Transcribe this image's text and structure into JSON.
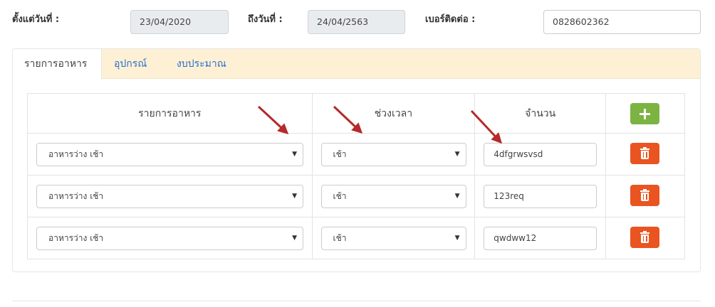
{
  "filters": {
    "start_date_label": "ตั้งแต่วันที่ :",
    "start_date_value": "23/04/2020",
    "end_date_label": "ถึงวันที่ :",
    "end_date_value": "24/04/2563",
    "phone_label": "เบอร์ติดต่อ :",
    "phone_value": "0828602362"
  },
  "tabs": [
    {
      "label": "รายการอาหาร",
      "active": true
    },
    {
      "label": "อุปกรณ์",
      "active": false
    },
    {
      "label": "งบประมาณ",
      "active": false
    }
  ],
  "table": {
    "headers": [
      "รายการอาหาร",
      "ช่วงเวลา",
      "จำนวน"
    ],
    "rows": [
      {
        "food": "อาหารว่าง เช้า",
        "period": "เช้า",
        "quantity": "4dfgrwsvsd"
      },
      {
        "food": "อาหารว่าง เช้า",
        "period": "เช้า",
        "quantity": "123req"
      },
      {
        "food": "อาหารว่าง เช้า",
        "period": "เช้า",
        "quantity": "qwdww12"
      }
    ]
  },
  "colors": {
    "tab_bar": "#fdf0d5",
    "add_button": "#7cb342",
    "delete_button": "#e95420",
    "annotation_arrow": "#b52a2a"
  },
  "icons": {
    "add": "plus-icon",
    "delete": "trash-icon",
    "dropdown": "caret-down-icon"
  }
}
